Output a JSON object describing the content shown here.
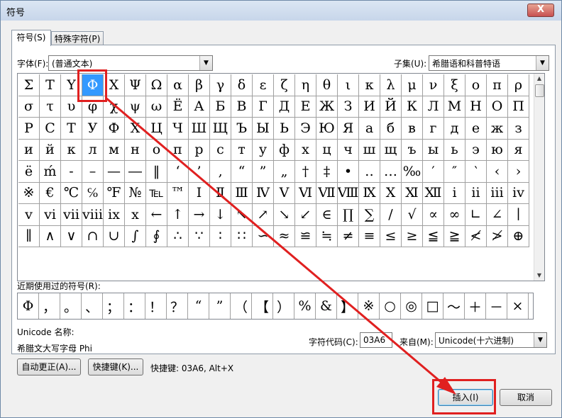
{
  "window": {
    "title": "符号",
    "close_label": "X"
  },
  "tabs": [
    "符号(S)",
    "特殊字符(P)"
  ],
  "font": {
    "label": "字体(F):",
    "value": "(普通文本)"
  },
  "subset": {
    "label": "子集(U):",
    "value": "希腊语和科普特语"
  },
  "symbol_rows": [
    [
      "Σ",
      "Τ",
      "Υ",
      "Φ",
      "Χ",
      "Ψ",
      "Ω",
      "α",
      "β",
      "γ",
      "δ",
      "ε",
      "ζ",
      "η",
      "θ",
      "ι",
      "κ",
      "λ",
      "μ",
      "ν",
      "ξ",
      "ο",
      "π",
      "ρ"
    ],
    [
      "σ",
      "τ",
      "υ",
      "φ",
      "χ",
      "ψ",
      "ω",
      "Ё",
      "А",
      "Б",
      "В",
      "Г",
      "Д",
      "Е",
      "Ж",
      "З",
      "И",
      "Й",
      "К",
      "Л",
      "М",
      "Н",
      "О",
      "П"
    ],
    [
      "Р",
      "С",
      "Т",
      "У",
      "Ф",
      "Х",
      "Ц",
      "Ч",
      "Ш",
      "Щ",
      "Ъ",
      "Ы",
      "Ь",
      "Э",
      "Ю",
      "Я",
      "а",
      "б",
      "в",
      "г",
      "д",
      "е",
      "ж",
      "з"
    ],
    [
      "и",
      "й",
      "к",
      "л",
      "м",
      "н",
      "о",
      "п",
      "р",
      "с",
      "т",
      "у",
      "ф",
      "х",
      "ц",
      "ч",
      "ш",
      "щ",
      "ъ",
      "ы",
      "ь",
      "э",
      "ю",
      "я"
    ],
    [
      "ё",
      "ḿ",
      "-",
      "–",
      "—",
      "―",
      "‖",
      "‘",
      "’",
      "‚",
      "“",
      "”",
      "„",
      "†",
      "‡",
      "•",
      "‥",
      "…",
      "‰",
      "′",
      "″",
      "‵",
      "‹",
      "›"
    ],
    [
      "※",
      "€",
      "℃",
      "℅",
      "℉",
      "№",
      "℡",
      "™",
      "Ⅰ",
      "Ⅱ",
      "Ⅲ",
      "Ⅳ",
      "Ⅴ",
      "Ⅵ",
      "Ⅶ",
      "Ⅷ",
      "Ⅸ",
      "Ⅹ",
      "Ⅺ",
      "Ⅻ",
      "ⅰ",
      "ⅱ",
      "ⅲ",
      "ⅳ"
    ],
    [
      "ⅴ",
      "ⅵ",
      "ⅶ",
      "ⅷ",
      "ⅸ",
      "ⅹ",
      "←",
      "↑",
      "→",
      "↓",
      "↖",
      "↗",
      "↘",
      "↙",
      "∈",
      "∏",
      "∑",
      "∕",
      "√",
      "∝",
      "∞",
      "∟",
      "∠",
      "∣"
    ],
    [
      "∥",
      "∧",
      "∨",
      "∩",
      "∪",
      "∫",
      "∮",
      "∴",
      "∵",
      "∶",
      "∷",
      "∽",
      "≈",
      "≌",
      "≒",
      "≠",
      "≡",
      "≤",
      "≥",
      "≦",
      "≧",
      "≮",
      "≯",
      "⊕"
    ]
  ],
  "selected_symbol": "Φ",
  "recent": {
    "label": "近期使用过的符号(R):",
    "symbols": [
      "Φ",
      "，",
      "。",
      "、",
      "；",
      "：",
      "！",
      "？",
      "“",
      "”",
      "（",
      "【",
      "）",
      "%",
      "&",
      "】",
      "※",
      "○",
      "◎",
      "□",
      "～",
      "＋",
      "－",
      "×"
    ]
  },
  "unicode_name": {
    "label": "Unicode 名称:",
    "value": "希腊文大写字母 Phi"
  },
  "char_code": {
    "label": "字符代码(C):",
    "value": "03A6"
  },
  "from": {
    "label": "来自(M):",
    "value": "Unicode(十六进制)"
  },
  "buttons": {
    "autocorrect": "自动更正(A)...",
    "shortcut_key": "快捷键(K)...",
    "insert": "插入(I)",
    "cancel": "取消"
  },
  "shortcut_text": "快捷键: 03A6, Alt+X",
  "colors": {
    "highlight": "#3399ff",
    "annotation": "#e02020"
  }
}
